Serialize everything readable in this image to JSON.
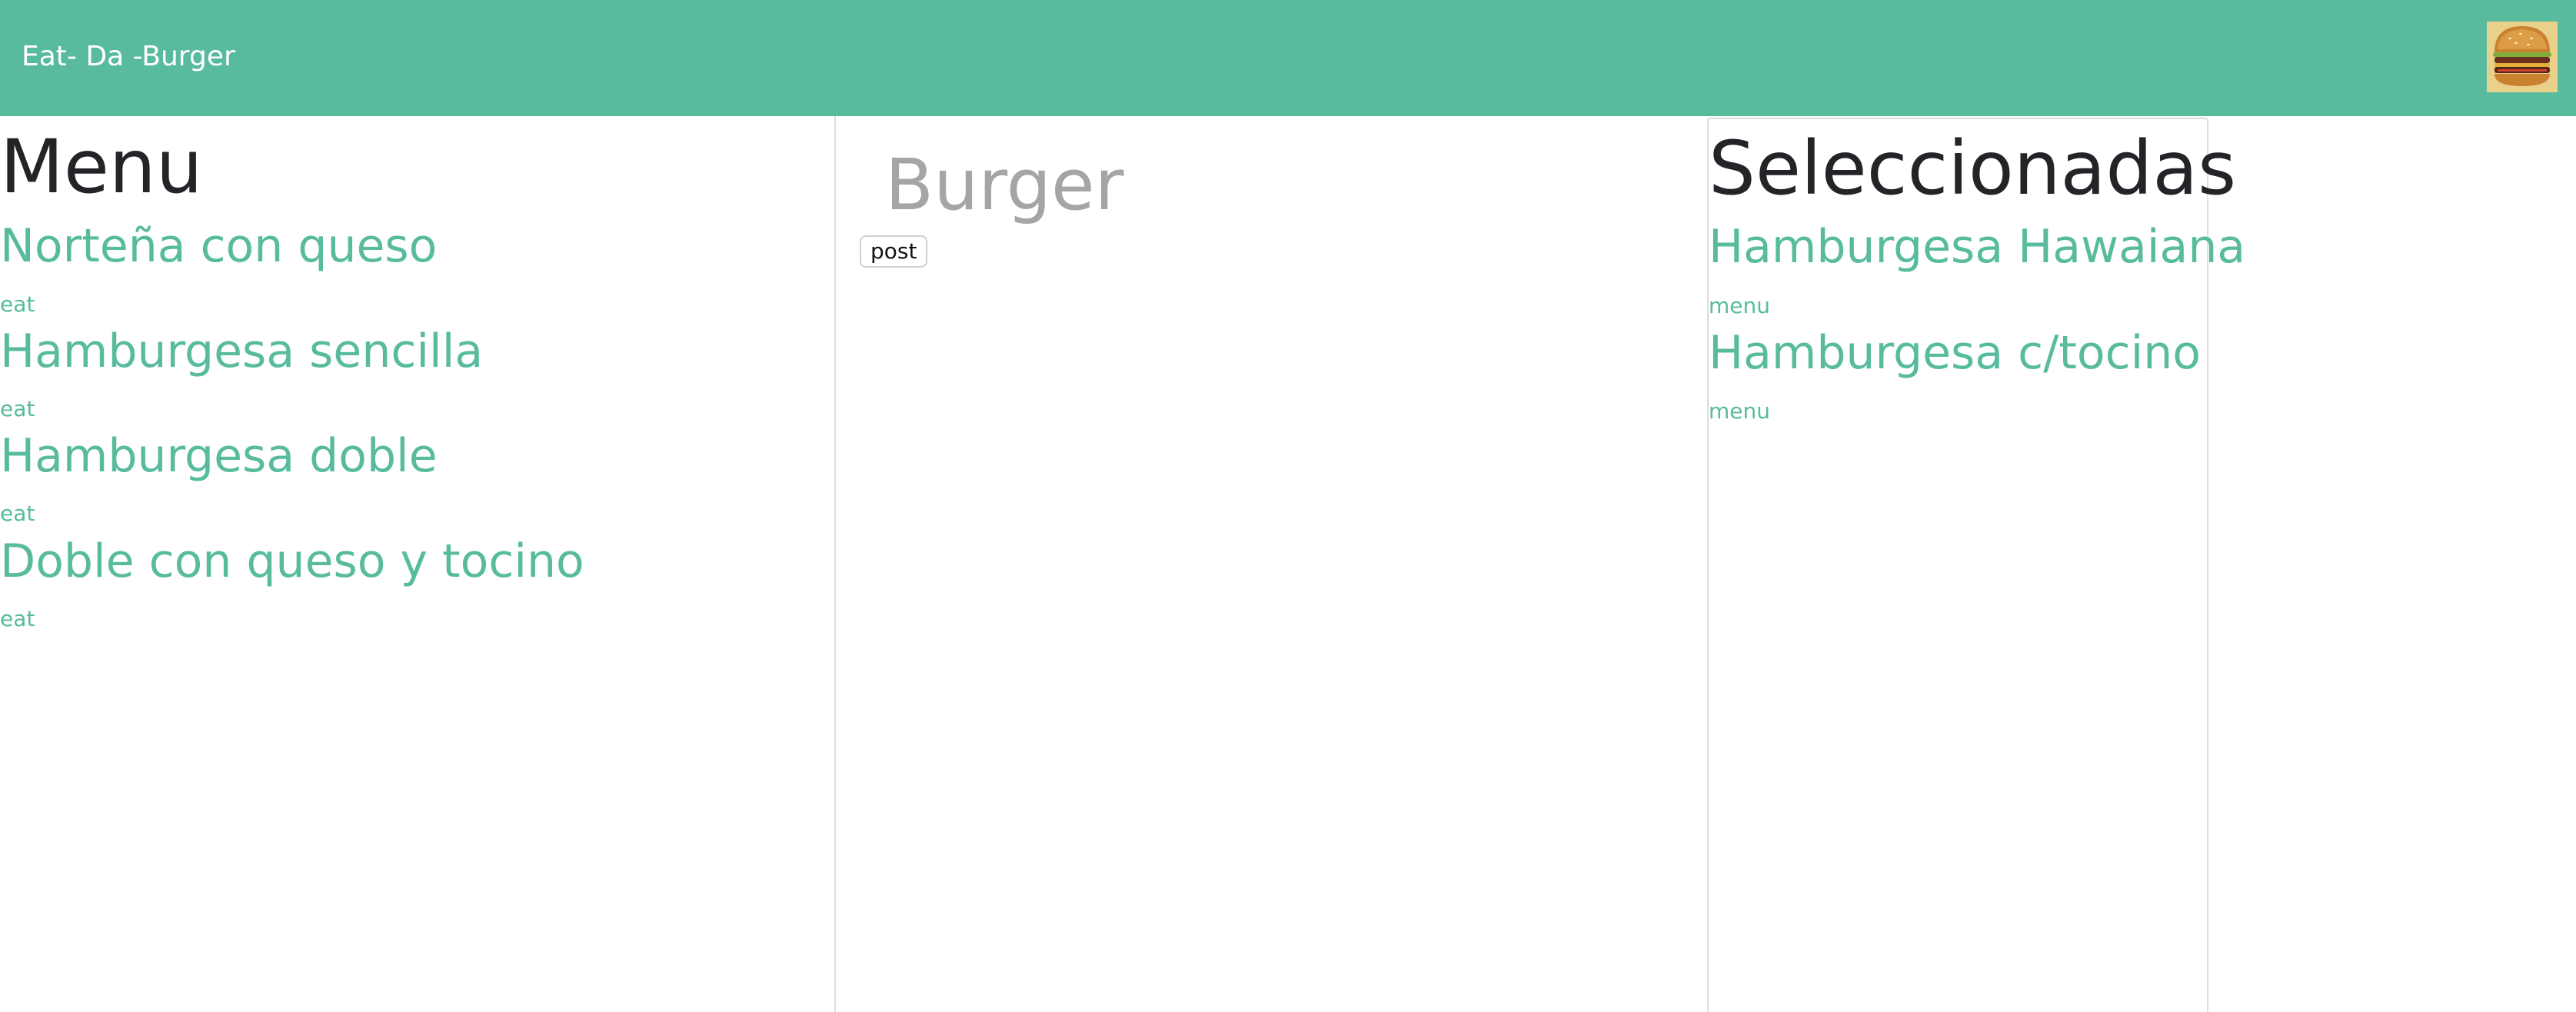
{
  "navbar": {
    "brand": "Eat- Da -Burger",
    "logo_icon": "burger-icon"
  },
  "menu": {
    "title": "Menu",
    "items": [
      {
        "name": "Norteña con queso",
        "action": "eat"
      },
      {
        "name": "Hamburgesa sencilla",
        "action": "eat"
      },
      {
        "name": "Hamburgesa doble",
        "action": "eat"
      },
      {
        "name": "Doble con queso y tocino",
        "action": "eat"
      }
    ]
  },
  "form": {
    "placeholder": "Burger",
    "submit_label": "post"
  },
  "selected": {
    "title": "Seleccionadas",
    "items": [
      {
        "name": "Hamburgesa Hawaiana",
        "action": "menu"
      },
      {
        "name": "Hamburgesa c/tocino",
        "action": "menu"
      }
    ]
  },
  "colors": {
    "accent": "#58bb9e",
    "text": "#222428",
    "placeholder": "#a5a5a5"
  }
}
